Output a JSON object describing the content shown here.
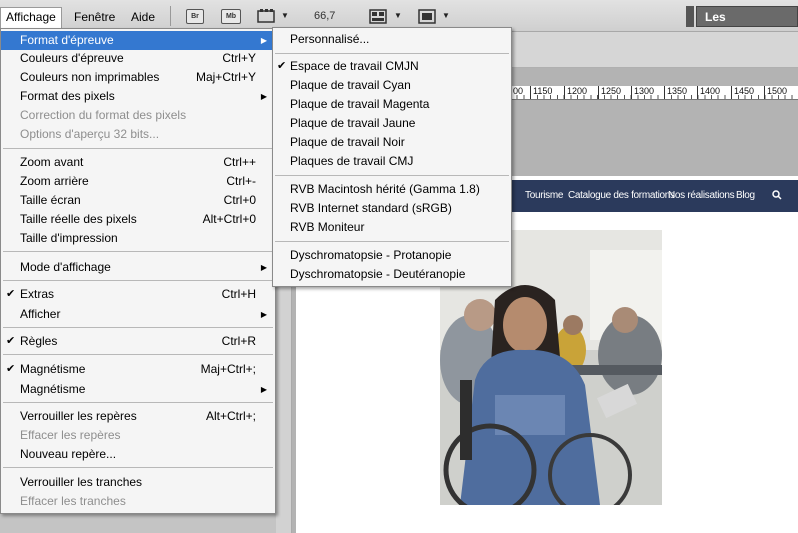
{
  "menubar": {
    "affichage": "Affichage",
    "fenetre": "Fenêtre",
    "aide": "Aide",
    "br": "Br",
    "mb": "Mb",
    "zoom": "66,7",
    "workspace": "Les indispensabl"
  },
  "ruler_ticks": [
    "00",
    "1150",
    "1200",
    "1250",
    "1300",
    "1350",
    "1400",
    "1450",
    "1500"
  ],
  "site_nav": [
    "Tourisme",
    "Catalogue des formations",
    "Nos réalisations",
    "Blog"
  ],
  "main_menu": [
    {
      "label": "Format d'épreuve",
      "shortcut": "",
      "submenu": true
    },
    {
      "label": "Couleurs d'épreuve",
      "shortcut": "Ctrl+Y"
    },
    {
      "label": "Couleurs non imprimables",
      "shortcut": "Maj+Ctrl+Y"
    },
    {
      "label": "Format des pixels",
      "shortcut": "",
      "submenu": true
    },
    {
      "label": "Correction du format des pixels",
      "shortcut": "",
      "disabled": true
    },
    {
      "label": "Options d'aperçu 32 bits...",
      "shortcut": "",
      "disabled": true
    },
    {
      "label": "Zoom avant",
      "shortcut": "Ctrl++"
    },
    {
      "label": "Zoom arrière",
      "shortcut": "Ctrl+-"
    },
    {
      "label": "Taille écran",
      "shortcut": "Ctrl+0"
    },
    {
      "label": "Taille réelle des pixels",
      "shortcut": "Alt+Ctrl+0"
    },
    {
      "label": "Taille d'impression",
      "shortcut": ""
    },
    {
      "label": "Mode d'affichage",
      "shortcut": "",
      "submenu": true
    },
    {
      "label": "Extras",
      "shortcut": "Ctrl+H",
      "checked": true
    },
    {
      "label": "Afficher",
      "shortcut": "",
      "submenu": true
    },
    {
      "label": "Règles",
      "shortcut": "Ctrl+R",
      "checked": true
    },
    {
      "label": "Magnétisme",
      "shortcut": "Maj+Ctrl+;",
      "checked": true
    },
    {
      "label": "Magnétisme",
      "shortcut": "",
      "submenu": true
    },
    {
      "label": "Verrouiller les repères",
      "shortcut": "Alt+Ctrl+;"
    },
    {
      "label": "Effacer les repères",
      "shortcut": "",
      "disabled": true
    },
    {
      "label": "Nouveau repère...",
      "shortcut": ""
    },
    {
      "label": "Verrouiller les tranches",
      "shortcut": ""
    },
    {
      "label": "Effacer les tranches",
      "shortcut": "",
      "disabled": true
    }
  ],
  "sub_menu": [
    {
      "label": "Personnalisé..."
    },
    {
      "label": "Espace de travail CMJN",
      "checked": true
    },
    {
      "label": "Plaque de travail Cyan"
    },
    {
      "label": "Plaque de travail Magenta"
    },
    {
      "label": "Plaque de travail Jaune"
    },
    {
      "label": "Plaque de travail Noir"
    },
    {
      "label": "Plaques de travail CMJ"
    },
    {
      "label": "RVB Macintosh hérité (Gamma 1.8)"
    },
    {
      "label": "RVB Internet standard (sRGB)"
    },
    {
      "label": "RVB Moniteur"
    },
    {
      "label": "Dyschromatopsie  - Protanopie"
    },
    {
      "label": "Dyschromatopsie  - Deutéranopie"
    }
  ],
  "colors": {
    "highlight": "#3478d0",
    "nav_bg": "#2b3a5c"
  }
}
